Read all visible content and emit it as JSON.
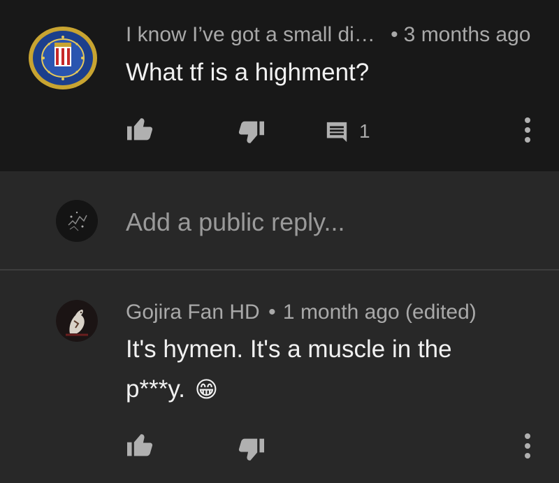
{
  "comment": {
    "author": "I know I’ve got a small di…",
    "separator": "•",
    "time": "3 months ago",
    "text": "What tf is a highment?",
    "reply_count": "1",
    "avatar_icon": "fbi-seal-icon",
    "like_icon": "thumbs-up-icon",
    "dislike_icon": "thumbs-down-icon",
    "reply_icon": "comment-icon",
    "menu_icon": "more-vert-icon"
  },
  "reply_box": {
    "placeholder": "Add a public reply...",
    "avatar_icon": "user-avatar-icon"
  },
  "reply": {
    "author": "Gojira Fan HD",
    "separator": "•",
    "time": "1 month ago (edited)",
    "text_line1": "It's hymen. It's a muscle in the",
    "text_line2": "p***y.",
    "emoji": "😁",
    "avatar_icon": "godzilla-avatar-icon"
  },
  "colors": {
    "top_bg": "#181818",
    "page_bg": "#282828",
    "meta_text": "#a9a9a9",
    "body_text": "#f1f1f1"
  }
}
